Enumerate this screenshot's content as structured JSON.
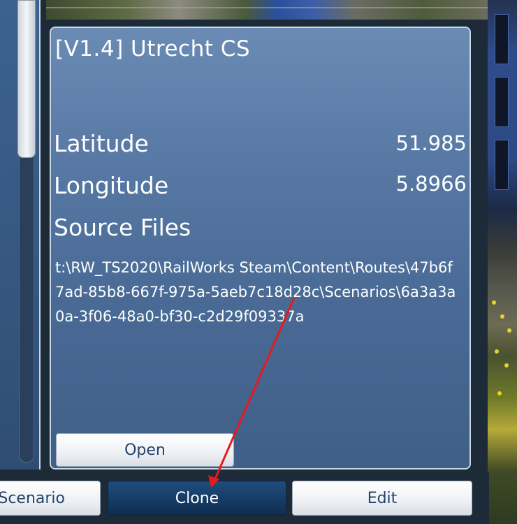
{
  "details": {
    "title": "[V1.4] Utrecht CS",
    "latitude_label": "Latitude",
    "latitude_value": "51.985",
    "longitude_label": "Longitude",
    "longitude_value": "5.8966",
    "source_files_label": "Source Files",
    "source_path": "t:\\RW_TS2020\\RailWorks Steam\\Content\\Routes\\47b6f7ad-85b8-667f-975a-5aeb7c18d28c\\Scenarios\\6a3a3a0a-3f06-48a0-bf30-c2d29f09337a",
    "open_label": "Open"
  },
  "actions": {
    "scenario_label": "Scenario",
    "clone_label": "Clone",
    "edit_label": "Edit"
  },
  "colors": {
    "panel": "#5779a4",
    "selected_button": "#163a63",
    "annotation_arrow": "#e8191c"
  }
}
